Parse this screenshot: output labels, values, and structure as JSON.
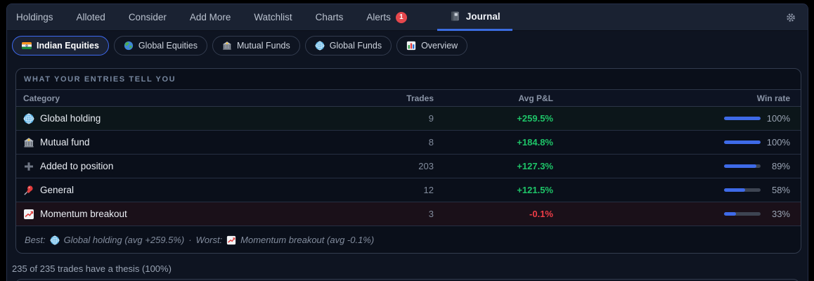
{
  "colors": {
    "accent_blue": "#3e6ae8",
    "positive_green": "#1ec468",
    "negative_red": "#ee3d47",
    "badge_red": "#e5484d",
    "win_bar_blue": "#3e6ae8"
  },
  "nav": {
    "items": [
      "Holdings",
      "Alloted",
      "Consider",
      "Add More",
      "Watchlist",
      "Charts",
      "Alerts"
    ],
    "alerts_badge": "1",
    "journal": {
      "label": "Journal",
      "icon": "notebook-icon"
    },
    "gear_icon": "gear-icon"
  },
  "filters": [
    {
      "icon": "india-flag-icon",
      "label": "Indian Equities",
      "active": true
    },
    {
      "icon": "globe-asia-icon",
      "label": "Global Equities",
      "active": false
    },
    {
      "icon": "bank-icon",
      "label": "Mutual Funds",
      "active": false
    },
    {
      "icon": "globe-meridians-icon",
      "label": "Global Funds",
      "active": false
    },
    {
      "icon": "bar-chart-icon",
      "label": "Overview",
      "active": false
    }
  ],
  "card": {
    "title": "WHAT YOUR ENTRIES TELL YOU",
    "columns": {
      "category": "Category",
      "trades": "Trades",
      "avg_pnl": "Avg P&L",
      "win_rate": "Win rate"
    },
    "rows": [
      {
        "icon": "globe-meridians-icon",
        "category": "Global holding",
        "trades": "9",
        "avg_pnl": "+259.5%",
        "pnl": "positive",
        "win_rate": 100,
        "win_label": "100%",
        "highlight": "best"
      },
      {
        "icon": "bank-icon",
        "category": "Mutual fund",
        "trades": "8",
        "avg_pnl": "+184.8%",
        "pnl": "positive",
        "win_rate": 100,
        "win_label": "100%",
        "highlight": "none"
      },
      {
        "icon": "plus-icon",
        "category": "Added to position",
        "trades": "203",
        "avg_pnl": "+127.3%",
        "pnl": "positive",
        "win_rate": 89,
        "win_label": "89%",
        "highlight": "none"
      },
      {
        "icon": "pushpin-icon",
        "category": "General",
        "trades": "12",
        "avg_pnl": "+121.5%",
        "pnl": "positive",
        "win_rate": 58,
        "win_label": "58%",
        "highlight": "none"
      },
      {
        "icon": "chart-up-icon",
        "category": "Momentum breakout",
        "trades": "3",
        "avg_pnl": "-0.1%",
        "pnl": "negative",
        "win_rate": 33,
        "win_label": "33%",
        "highlight": "worst"
      }
    ],
    "summary": {
      "best_label": "Best:",
      "best_icon": "globe-meridians-icon",
      "best_text": "Global holding (avg +259.5%)",
      "separator": "·",
      "worst_label": "Worst:",
      "worst_icon": "chart-up-icon",
      "worst_text": "Momentum breakout (avg -0.1%)"
    }
  },
  "footer_note": "235 of 235 trades have a thesis (100%)"
}
